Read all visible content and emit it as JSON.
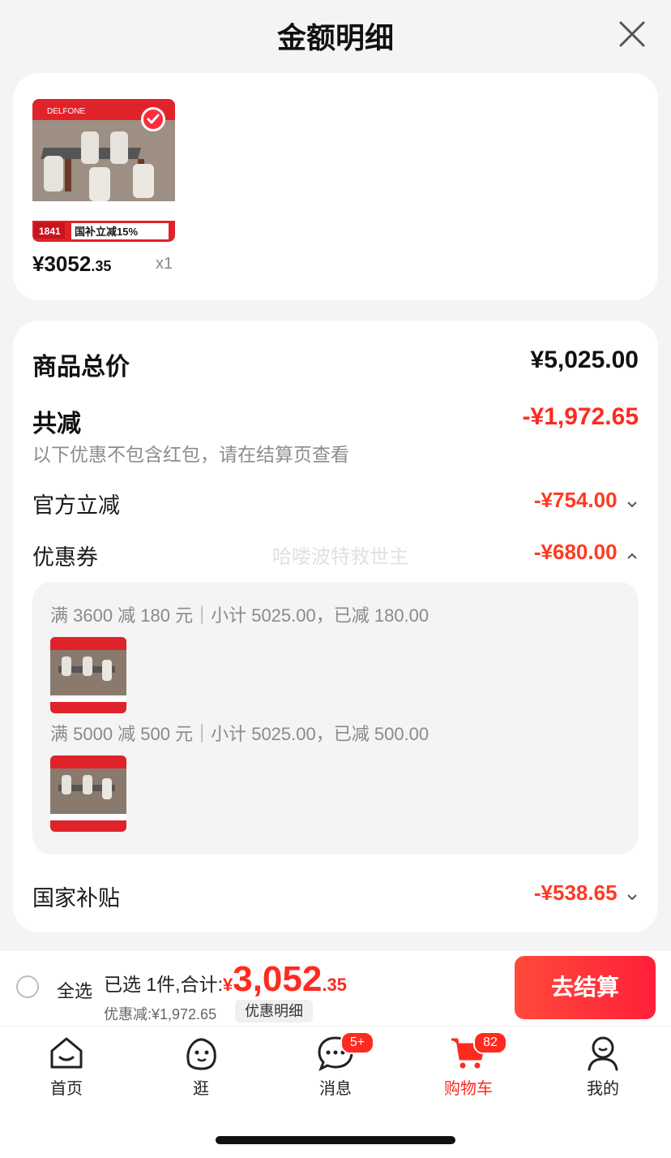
{
  "header": {
    "title": "金额明细"
  },
  "product": {
    "price_int": "¥3052",
    "price_dec": ".35",
    "qty": "x1",
    "image_text": {
      "brand": "DELFONE",
      "price_tag": "1841",
      "promo": "国补立减15%"
    }
  },
  "summary": {
    "total_label": "商品总价",
    "total_value": "¥5,025.00",
    "reduce_label": "共减",
    "reduce_value": "-¥1,972.65",
    "note": "以下优惠不包含红包，请在结算页查看",
    "items": [
      {
        "label": "官方立减",
        "value": "-¥754.00"
      },
      {
        "label": "优惠券",
        "value": "-¥680.00"
      },
      {
        "label": "国家补贴",
        "value": "-¥538.65"
      }
    ],
    "watermark": "哈喽波特救世主",
    "coupons": [
      {
        "text": "满 3600 减 180 元｜小计 5025.00，已减 180.00"
      },
      {
        "text": "满 5000 减 500 元｜小计 5025.00，已减 500.00"
      }
    ]
  },
  "bottom_bar": {
    "select_all": "全选",
    "selected_text": "已选 1件,合计:",
    "yen": "¥",
    "total_big": "3,052",
    "total_dec": ".35",
    "discount_text": "优惠减:¥1,972.65",
    "discount_detail": "优惠明细",
    "checkout": "去结算"
  },
  "tabs": [
    {
      "label": "首页",
      "icon": "home-icon"
    },
    {
      "label": "逛",
      "icon": "browse-icon"
    },
    {
      "label": "消息",
      "icon": "message-icon",
      "badge": "5+"
    },
    {
      "label": "购物车",
      "icon": "cart-icon",
      "badge": "82",
      "active": true
    },
    {
      "label": "我的",
      "icon": "profile-icon"
    }
  ],
  "colors": {
    "accent": "#ff2a1f",
    "background": "#f4f4f4"
  }
}
